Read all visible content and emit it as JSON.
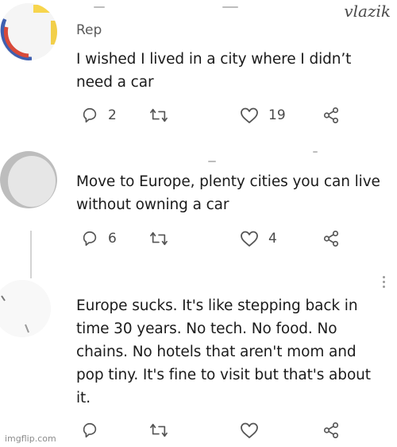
{
  "tweets": [
    {
      "handle": "Rep",
      "text": "I wished I lived in a city where I didn’t need a car",
      "replies": "2",
      "likes": "19"
    },
    {
      "text": "Move to Europe, plenty cities you can live without owning a car",
      "replies": "6",
      "likes": "4"
    },
    {
      "text": "Europe sucks.  It's like stepping back in time 30 years.  No tech.  No food.  No chains.  No hotels that aren't mom and pop tiny.  It's fine to visit but that's about it."
    }
  ],
  "top_right_mark": "vlazik",
  "watermark": "imgflip.com",
  "icons": [
    "reply-icon",
    "retweet-icon",
    "like-icon",
    "share-icon",
    "more-icon"
  ]
}
